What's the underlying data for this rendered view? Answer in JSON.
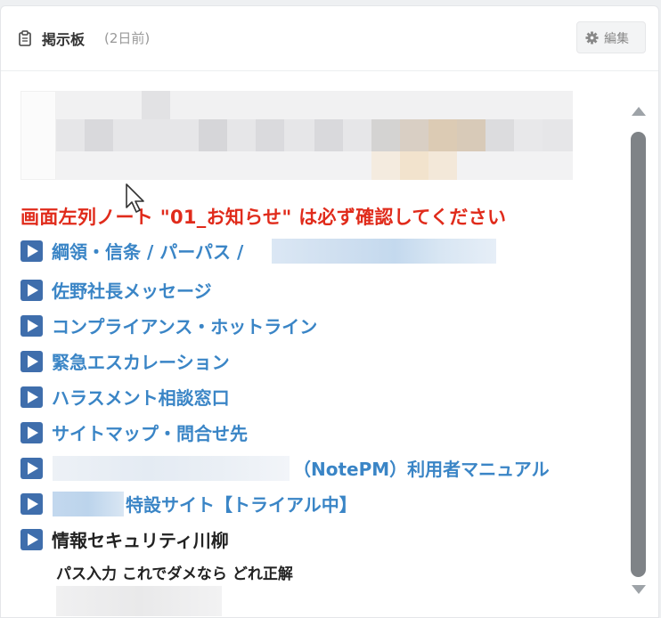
{
  "header": {
    "title": "掲示板",
    "subtitle": "(2日前)",
    "edit_label": "編集"
  },
  "notice": "画面左列ノート \"01_お知らせ\" は必ず確認してください",
  "links": [
    {
      "label": "綱領・信条 / パーパス /",
      "redacted": true
    },
    {
      "label": "佐野社長メッセージ"
    },
    {
      "label": "コンプライアンス・ホットライン"
    },
    {
      "label": "緊急エスカレーション"
    },
    {
      "label": "ハラスメント相談窓口"
    },
    {
      "label": "サイトマップ・問合せ先"
    },
    {
      "label": "（NotePM）利用者マニュアル",
      "redacted_prefix": true
    },
    {
      "label": "特設サイト【トライアル中】",
      "redacted_prefix": true
    }
  ],
  "section": {
    "label": "情報セキュリティ川柳",
    "line1": "パス入力 これでダメなら どれ正解"
  },
  "icons": {
    "header_icon": "clipboard-icon",
    "edit_icon": "gear-icon",
    "link_icon": "play-icon"
  },
  "colors": {
    "notice": "#e02b1b",
    "link": "#3a85c6",
    "icon": "#3f6eac"
  }
}
